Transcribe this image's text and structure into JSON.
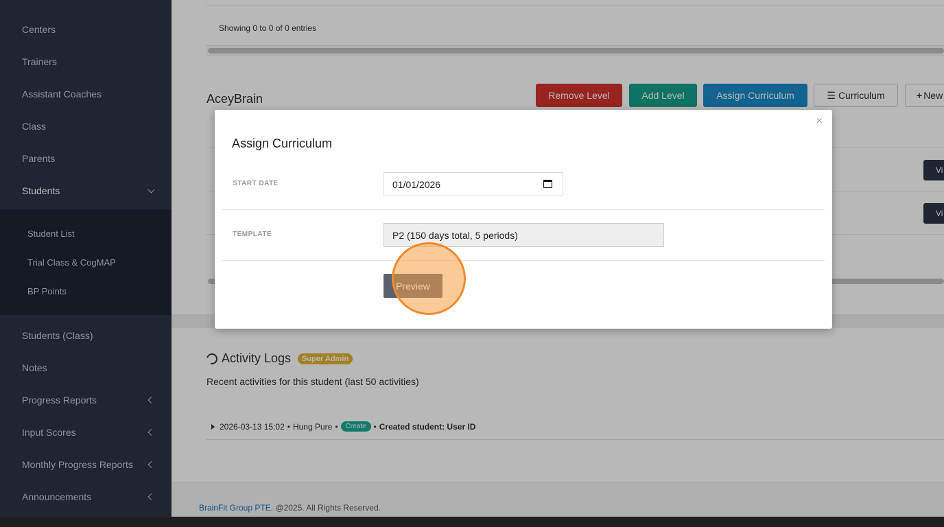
{
  "sidebar": {
    "items": [
      {
        "label": "Centers"
      },
      {
        "label": "Trainers"
      },
      {
        "label": "Assistant Coaches"
      },
      {
        "label": "Class"
      },
      {
        "label": "Parents"
      },
      {
        "label": "Students"
      },
      {
        "label": "Students (Class)"
      },
      {
        "label": "Notes"
      },
      {
        "label": "Progress Reports"
      },
      {
        "label": "Input Scores"
      },
      {
        "label": "Monthly Progress Reports"
      },
      {
        "label": "Announcements"
      }
    ],
    "students_submenu": [
      {
        "label": "Student List"
      },
      {
        "label": "Trial Class & CogMAP"
      },
      {
        "label": "BP Points"
      }
    ]
  },
  "main": {
    "showing_text": "Showing 0 to 0 of 0 entries",
    "section_title": "AceyBrain",
    "buttons": {
      "remove_level": "Remove Level",
      "add_level": "Add Level",
      "assign_curriculum": "Assign Curriculum",
      "curriculum": "Curriculum",
      "new": "New"
    },
    "view_label": "Vi"
  },
  "activity": {
    "title": "Activity Logs",
    "badge": "Super Admin",
    "description": "Recent activities for this student (last 50 activities)",
    "log": {
      "timestamp": "2026-03-13 15:02",
      "user": "Hung Pure",
      "action": "Create",
      "message": "Created student: User ID"
    }
  },
  "footer": {
    "company": "BrainFit Group PTE.",
    "rights": "@2025. All Rights Reserved."
  },
  "modal": {
    "title": "Assign Curriculum",
    "close": "×",
    "start_date_label": "START DATE",
    "start_date_value": "01/01/2026",
    "template_label": "TEMPLATE",
    "template_value": "P2 (150 days total, 5 periods)",
    "preview_label": "Preview"
  },
  "icons": [
    "chevron-left-icon",
    "chevron-down-icon",
    "list-icon",
    "plus-icon",
    "history-icon",
    "calendar-icon",
    "close-icon",
    "caret-right-icon"
  ],
  "colors": {
    "sidebar": "#2d3446",
    "remove": "#d2322d",
    "add": "#13a088",
    "assign": "#1a8ac6",
    "badge_admin": "#e2b230",
    "badge_create": "#1aaa94",
    "click_marker": "#f08a2e"
  }
}
